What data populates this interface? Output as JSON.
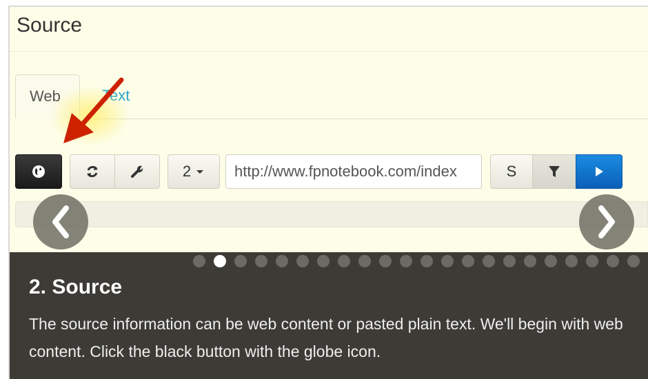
{
  "panel": {
    "title": "Source",
    "tabs": [
      {
        "label": "Web",
        "active": true
      },
      {
        "label": "Text",
        "active": false
      }
    ]
  },
  "toolbar": {
    "globe_icon": "globe-icon",
    "refresh_icon": "refresh-icon",
    "wrench_icon": "wrench-icon",
    "count_value": "2",
    "url_value": "http://www.fpnotebook.com/index",
    "s_label": "S",
    "filter_icon": "filter-icon",
    "play_icon": "play-icon"
  },
  "carousel": {
    "prev_icon": "chevron-left-icon",
    "next_icon": "chevron-right-icon",
    "total_dots": 22,
    "active_dot": 2
  },
  "caption": {
    "title": "2. Source",
    "text": "The source information can be web content or pasted plain text. We'll begin with web content. Click the black button with the globe icon."
  },
  "colors": {
    "background": "#fdfde8",
    "caption_bg": "#3d3b36",
    "tab_link": "#2aa6c9",
    "primary_blue": "#0a6ccc",
    "arrow_red": "#cc2200"
  }
}
